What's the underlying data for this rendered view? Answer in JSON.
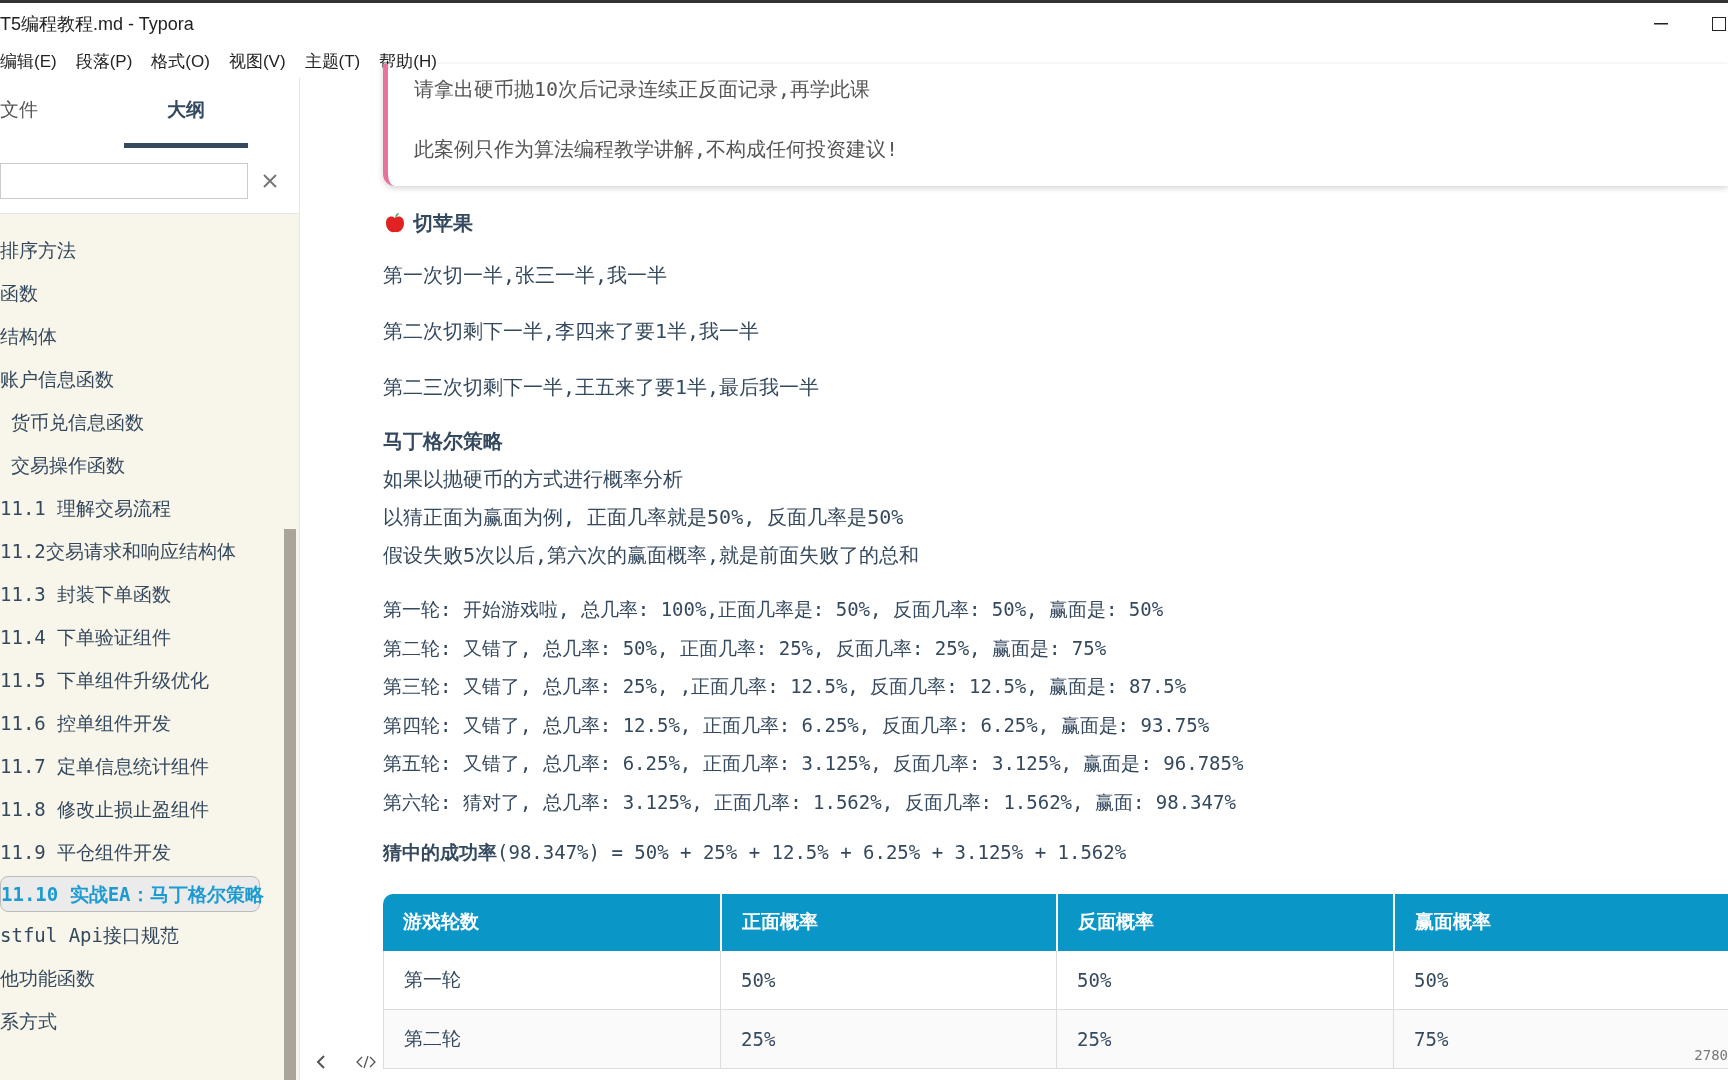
{
  "window": {
    "title": "T5编程教程.md - Typora"
  },
  "menu": [
    "编辑(E)",
    "段落(P)",
    "格式(O)",
    "视图(V)",
    "主题(T)",
    "帮助(H)"
  ],
  "sidebar": {
    "tabs": [
      {
        "label": "文件",
        "selected": false
      },
      {
        "label": "大纲",
        "selected": true
      }
    ],
    "items": [
      {
        "label": "排序方法",
        "selected": false
      },
      {
        "label": "函数",
        "selected": false
      },
      {
        "label": "结构体",
        "selected": false
      },
      {
        "label": "账户信息函数",
        "selected": false
      },
      {
        "label": " 货币兑信息函数",
        "selected": false
      },
      {
        "label": " 交易操作函数",
        "selected": false
      },
      {
        "label": "11.1 理解交易流程",
        "selected": false
      },
      {
        "label": "11.2交易请求和响应结构体",
        "selected": false
      },
      {
        "label": "11.3 封装下单函数",
        "selected": false
      },
      {
        "label": "11.4 下单验证组件",
        "selected": false
      },
      {
        "label": "11.5 下单组件升级优化",
        "selected": false
      },
      {
        "label": "11.6 控单组件开发",
        "selected": false
      },
      {
        "label": "11.7 定单信息统计组件",
        "selected": false
      },
      {
        "label": "11.8 修改止损止盈组件",
        "selected": false
      },
      {
        "label": "11.9 平仓组件开发",
        "selected": false
      },
      {
        "label": "11.10 实战EA：马丁格尔策略",
        "selected": true
      },
      {
        "label": "stful Api接口规范",
        "selected": false
      },
      {
        "label": "他功能函数",
        "selected": false
      },
      {
        "label": "系方式",
        "selected": false
      }
    ]
  },
  "document": {
    "callout": [
      "请拿出硬币抛10次后记录连续正反面记录,再学此课",
      "此案例只作为算法编程教学讲解,不构成任何投资建议!"
    ],
    "heading": "切苹果",
    "paragraphs": [
      "第一次切一半,张三一半,我一半",
      "第二次切剩下一半,李四来了要1半,我一半",
      "第二三次切剩下一半,王五来了要1半,最后我一半"
    ],
    "strategy_title": "马丁格尔策略",
    "strategy_lines": [
      "如果以抛硬币的方式进行概率分析",
      "以猜正面为赢面为例, 正面几率就是50%, 反面几率是50%",
      "假设失败5次以后,第六次的赢面概率,就是前面失败了的总和"
    ],
    "rounds": [
      "第一轮: 开始游戏啦, 总几率: 100%,正面几率是: 50%, 反面几率: 50%, 赢面是: 50%",
      "第二轮: 又错了, 总几率: 50%, 正面几率: 25%, 反面几率: 25%, 赢面是: 75%",
      "第三轮: 又错了, 总几率: 25%, ,正面几率: 12.5%, 反面几率: 12.5%, 赢面是: 87.5%",
      "第四轮: 又错了, 总几率: 12.5%, 正面几率: 6.25%, 反面几率: 6.25%, 赢面是: 93.75%",
      "第五轮: 又错了, 总几率: 6.25%, 正面几率: 3.125%, 反面几率: 3.125%, 赢面是: 96.785%",
      "第六轮: 猜对了, 总几率: 3.125%, 正面几率: 1.562%, 反面几率: 1.562%, 赢面: 98.347%"
    ],
    "summary": "**猜中的成功率**(98.347%) = 50% + 25% + 12.5% + 6.25% + 3.125% + 1.562%",
    "table": {
      "columns": [
        "游戏轮数",
        "正面概率",
        "反面概率",
        "赢面概率"
      ],
      "rows": [
        [
          "第一轮",
          "50%",
          "50%",
          "50%"
        ],
        [
          "第二轮",
          "25%",
          "25%",
          "75%"
        ]
      ]
    }
  },
  "status_bar": {
    "word_count": "2780"
  }
}
